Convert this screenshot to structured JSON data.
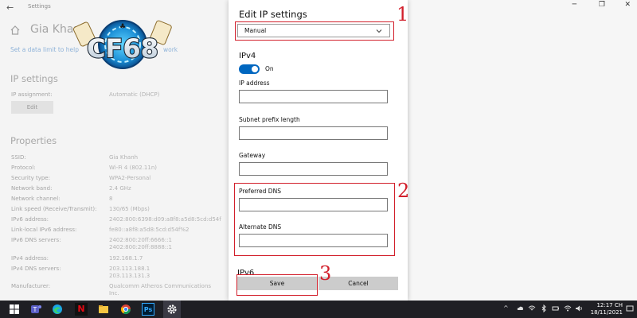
{
  "window": {
    "app_title": "Settings",
    "back_glyph": "←",
    "controls": {
      "minimize": "─",
      "restore": "❐",
      "close": "✕"
    }
  },
  "left": {
    "network_name": "Gia Khanh",
    "data_limit_link": "Set a data limit to help",
    "link_tail": "work",
    "ip_settings_title": "IP settings",
    "ip_assignment_label": "IP assignment:",
    "ip_assignment_value": "Automatic (DHCP)",
    "edit_label": "Edit",
    "properties_title": "Properties",
    "properties": [
      {
        "key": "SSID:",
        "value": "Gia Khanh"
      },
      {
        "key": "Protocol:",
        "value": "Wi-Fi 4 (802.11n)"
      },
      {
        "key": "Security type:",
        "value": "WPA2-Personal"
      },
      {
        "key": "Network band:",
        "value": "2.4 GHz"
      },
      {
        "key": "Network channel:",
        "value": "8"
      },
      {
        "key": "Link speed (Receive/Transmit):",
        "value": "130/65 (Mbps)"
      },
      {
        "key": "IPv6 address:",
        "value": "2402:800:6398:d09:a8f8:a5d8:5cd:d54f"
      },
      {
        "key": "Link-local IPv6 address:",
        "value": "fe80::a8f8:a5d8:5cd:d54f%2"
      },
      {
        "key": "IPv6 DNS servers:",
        "value": "2402:800:20ff:6666::1"
      },
      {
        "key": "",
        "value": "2402:800:20ff:8888::1"
      },
      {
        "key": "IPv4 address:",
        "value": "192.168.1.7"
      },
      {
        "key": "IPv4 DNS servers:",
        "value": "203.113.188.1"
      },
      {
        "key": "",
        "value": "203.113.131.3"
      },
      {
        "key": "Manufacturer:",
        "value": "Qualcomm Atheros Communications"
      },
      {
        "key": "",
        "value": "Inc."
      }
    ]
  },
  "logo": {
    "text": "CF68"
  },
  "dialog": {
    "title": "Edit IP settings",
    "mode_value": "Manual",
    "ipv4_title": "IPv4",
    "toggle_label": "On",
    "fields": {
      "ip_address": {
        "label": "IP address",
        "value": ""
      },
      "subnet": {
        "label": "Subnet prefix length",
        "value": ""
      },
      "gateway": {
        "label": "Gateway",
        "value": ""
      },
      "preferred_dns": {
        "label": "Preferred DNS",
        "value": ""
      },
      "alternate_dns": {
        "label": "Alternate DNS",
        "value": ""
      }
    },
    "ipv6_title": "IPv6",
    "save_label": "Save",
    "cancel_label": "Cancel"
  },
  "annotations": {
    "n1": "1",
    "n2": "2",
    "n3": "3",
    "color": "#d21f2b"
  },
  "taskbar": {
    "time": "12:17 CH",
    "date": "18/11/2021",
    "icons": [
      "windows-icon",
      "teams-icon",
      "edge-icon",
      "netflix-icon",
      "file-explorer-icon",
      "chrome-icon",
      "photoshop-icon",
      "settings-icon"
    ],
    "netflix_letter": "N",
    "photoshop_letters": "Ps",
    "tray_chevron": "^"
  },
  "colors": {
    "accent": "#0067c0",
    "annotation": "#d21f2b",
    "taskbar": "#1f1f24"
  }
}
